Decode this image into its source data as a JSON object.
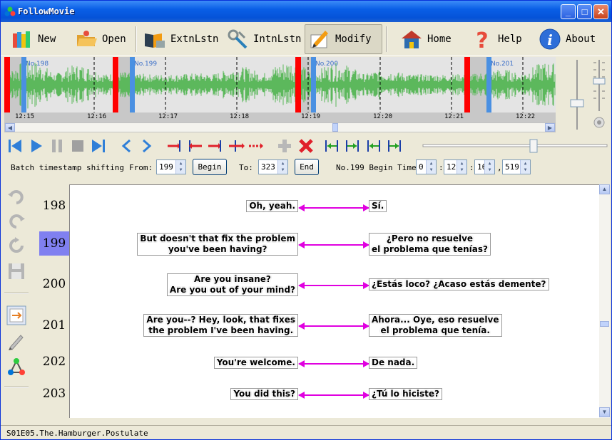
{
  "app": {
    "title": "FollowMovie"
  },
  "window_buttons": {
    "minimize": "_",
    "maximize": "□",
    "close": "✕"
  },
  "toolbar": [
    {
      "label": "New",
      "icon": "books-icon"
    },
    {
      "label": "Open",
      "icon": "open-folder-icon"
    },
    {
      "label": "ExtnLstn",
      "icon": "external-listen-icon"
    },
    {
      "label": "IntnLstn",
      "icon": "internal-listen-icon"
    },
    {
      "label": "Modify",
      "icon": "modify-pencil-icon",
      "active": true
    },
    {
      "label": "Home",
      "icon": "home-icon"
    },
    {
      "label": "Help",
      "icon": "help-question-icon"
    },
    {
      "label": "About",
      "icon": "info-icon"
    }
  ],
  "waveform": {
    "segments": [
      "No.198",
      "No.199",
      "No.200",
      "No.201"
    ],
    "times": [
      "12:15",
      "12:16",
      "12:17",
      "12:18",
      "12:19",
      "12:20",
      "12:21",
      "12:22"
    ],
    "colors": {
      "wave": "#5cb85c",
      "marker_red": "#ff0000",
      "marker_blue": "#4a90e2"
    }
  },
  "batch": {
    "label": "Batch timestamp shifting",
    "from_label": "From:",
    "from_value": "199",
    "begin_button": "Begin",
    "to_label": "To:",
    "to_value": "323",
    "end_button": "End",
    "begin_time_label": "No.199 Begin Time",
    "time_h": "0",
    "time_m": "12",
    "time_s": "16",
    "time_ms": "519"
  },
  "rows": [
    {
      "num": "198",
      "left": "Oh, yeah.",
      "right": "Sí.",
      "selected": false
    },
    {
      "num": "199",
      "left": "But doesn't that fix the problem\nyou've been having?",
      "right": "¿Pero no resuelve\nel problema que tenías?",
      "selected": true
    },
    {
      "num": "200",
      "left": "Are you insane?\nAre you out of your mind?",
      "right": "¿Estás loco? ¿Acaso estás demente?",
      "selected": false
    },
    {
      "num": "201",
      "left": "Are you--? Hey, look, that fixes\nthe problem I've been having.",
      "right": "Ahora... Oye, eso resuelve\nel problema que tenía.",
      "selected": false
    },
    {
      "num": "202",
      "left": "You're welcome.",
      "right": "De nada.",
      "selected": false
    },
    {
      "num": "203",
      "left": "You did this?",
      "right": "¿Tú lo hiciste?",
      "selected": false
    }
  ],
  "status": {
    "file": "S01E05.The.Hamburger.Postulate"
  }
}
